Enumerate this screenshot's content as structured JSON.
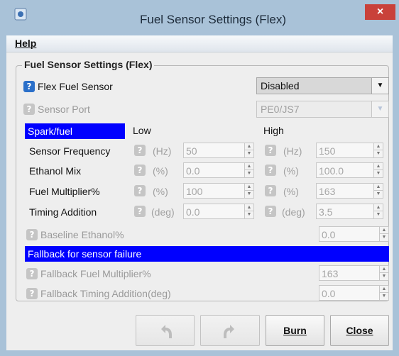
{
  "window": {
    "title": "Fuel Sensor Settings (Flex)",
    "close_glyph": "×"
  },
  "menu": {
    "help": "Help"
  },
  "group": {
    "title": "Fuel Sensor Settings (Flex)"
  },
  "flex": {
    "label": "Flex Fuel Sensor",
    "value": "Disabled"
  },
  "port": {
    "label": "Sensor Port",
    "value": "PE0/JS7"
  },
  "header": {
    "spark_fuel": "Spark/fuel",
    "low": "Low",
    "high": "High"
  },
  "rows": [
    {
      "label": "Sensor Frequency",
      "unit": "(Hz)",
      "low": "50",
      "high": "150"
    },
    {
      "label": "Ethanol Mix",
      "unit": "(%)",
      "low": "0.0",
      "high": "100.0"
    },
    {
      "label": "Fuel Multiplier%",
      "unit": "(%)",
      "low": "100",
      "high": "163"
    },
    {
      "label": "Timing Addition",
      "unit": "(deg)",
      "low": "0.0",
      "high": "3.5"
    }
  ],
  "baseline": {
    "label": "Baseline Ethanol%",
    "value": "0.0"
  },
  "fallback": {
    "header": "Fallback for sensor failure",
    "fuel_label": "Fallback Fuel Multiplier%",
    "fuel_value": "163",
    "timing_label": "Fallback Timing Addition(deg)",
    "timing_value": "0.0"
  },
  "buttons": {
    "burn": "Burn",
    "close": "Close"
  },
  "icons": {
    "help": "question-icon",
    "undo": "undo-icon",
    "redo": "redo-icon"
  },
  "colors": {
    "accent": "#0000ff",
    "help_icon": "#2a6fc9",
    "titlebar": "#a9c2d8",
    "close": "#c9413a"
  }
}
